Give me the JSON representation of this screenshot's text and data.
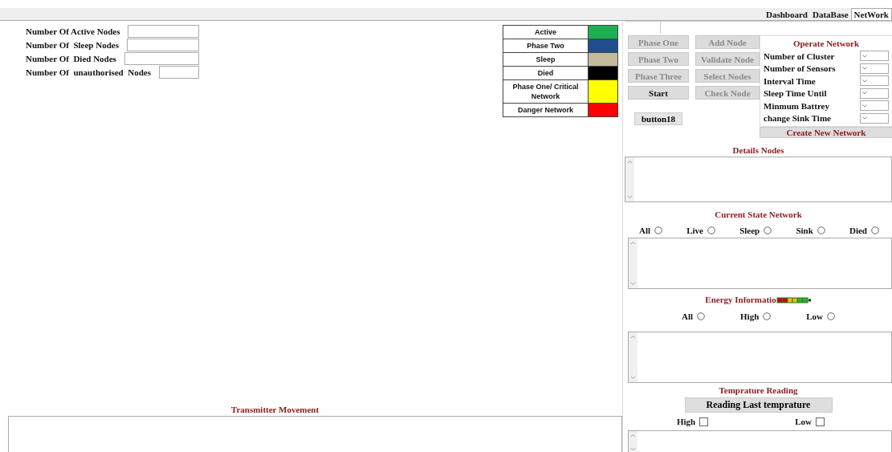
{
  "tabs": [
    {
      "label": "Dashboard",
      "selected": false
    },
    {
      "label": "DataBase",
      "selected": false
    },
    {
      "label": "NetWork",
      "selected": true
    }
  ],
  "node_counts": [
    {
      "label": "Number Of Active Nodes"
    },
    {
      "label": "Number Of  Sleep Nodes"
    },
    {
      "label": "Number Of  Died Nodes"
    },
    {
      "label": "Number Of  unauthorised  Nodes"
    }
  ],
  "legend": [
    {
      "label": "Active",
      "color": "#1db050"
    },
    {
      "label": "Phase Two",
      "color": "#1f4e8c"
    },
    {
      "label": "Sleep",
      "color": "#c4bb9c"
    },
    {
      "label": "Died",
      "color": "#000000"
    },
    {
      "label": "Phase One/ Critical Network",
      "color": "#ffff00"
    },
    {
      "label": "Danger Network",
      "color": "#ff0000"
    }
  ],
  "phase_buttons": [
    {
      "label": "Phase One",
      "disabled": true
    },
    {
      "label": "Phase Two",
      "disabled": true
    },
    {
      "label": "Phase Three",
      "disabled": true
    },
    {
      "label": "Start",
      "disabled": false
    }
  ],
  "node_buttons": [
    {
      "label": "Add Node",
      "disabled": true
    },
    {
      "label": "Validate Node",
      "disabled": true
    },
    {
      "label": "Select Nodes",
      "disabled": true
    },
    {
      "label": "Check Node",
      "disabled": true
    }
  ],
  "extra_button": {
    "label": "button18"
  },
  "operate_network": {
    "title": "Operate Network",
    "settings": [
      {
        "label": "Number of Cluster"
      },
      {
        "label": "Number of Sensors"
      },
      {
        "label": "Interval Time"
      },
      {
        "label": "Sleep Time Until"
      },
      {
        "label": "Minmum Battrey"
      },
      {
        "label": "change Sink Time"
      }
    ],
    "create_button": "Create New Network"
  },
  "details_nodes": {
    "title": "Details Nodes"
  },
  "current_state": {
    "title": "Current State Network",
    "options": [
      {
        "label": "All",
        "selected": false
      },
      {
        "label": "Live",
        "selected": false
      },
      {
        "label": "Sleep",
        "selected": false
      },
      {
        "label": "Sink",
        "selected": false
      },
      {
        "label": "Died",
        "selected": false
      }
    ]
  },
  "energy": {
    "title": "Energy Informatio",
    "options": [
      {
        "label": "All",
        "selected": false
      },
      {
        "label": "High",
        "selected": false
      },
      {
        "label": "Low",
        "selected": false
      }
    ]
  },
  "temperature": {
    "title": "Temprature Reading",
    "button": "Reading Last temprature",
    "checks": [
      {
        "label": "High",
        "checked": false
      },
      {
        "label": "Low",
        "checked": false
      }
    ]
  },
  "transmitter": {
    "title": "Transmitter Movement"
  }
}
